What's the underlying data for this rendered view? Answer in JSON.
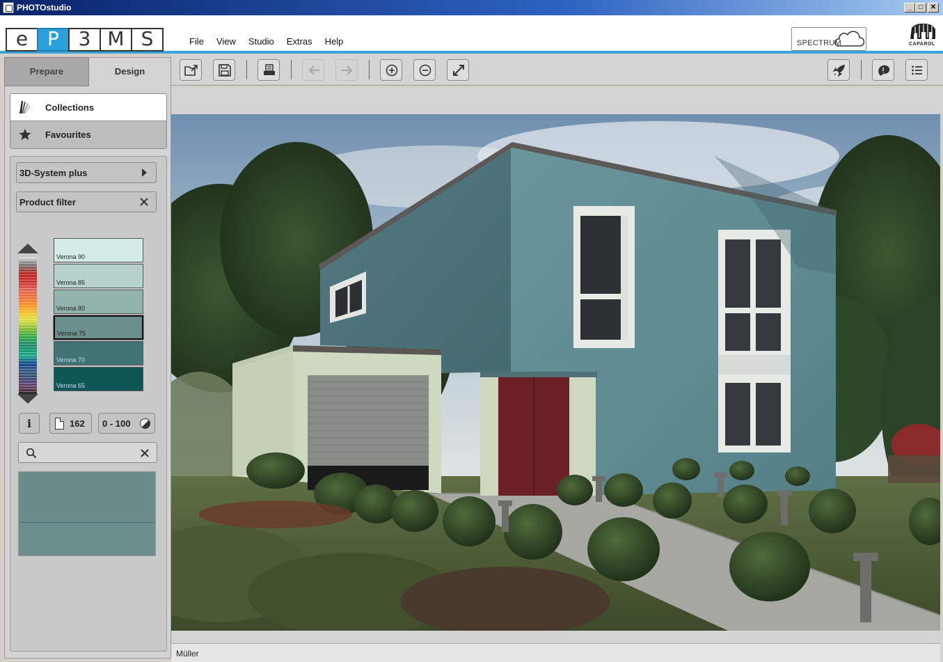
{
  "window": {
    "title": "PHOTOstudio",
    "minimize": "_",
    "maximize": "□",
    "close": "✕"
  },
  "logo_tiles": [
    "e",
    "P",
    "3",
    "M",
    "S"
  ],
  "menu": [
    "File",
    "View",
    "Studio",
    "Extras",
    "Help"
  ],
  "spectrum_label": "SPECTRUM",
  "brand": "CAPAROL",
  "tabs": {
    "prepare": "Prepare",
    "design": "Design"
  },
  "collections": {
    "collections_label": "Collections",
    "favourites_label": "Favourites"
  },
  "filters": {
    "system": "3D-System plus",
    "product_filter": "Product filter"
  },
  "swatches": [
    {
      "name": "Verona 90",
      "color": "#d3ebe6"
    },
    {
      "name": "Verona 85",
      "color": "#b5d2cd"
    },
    {
      "name": "Verona 80",
      "color": "#93b3ae"
    },
    {
      "name": "Verona 75",
      "color": "#6b8f8c"
    },
    {
      "name": "Verona 70",
      "color": "#3f7374"
    },
    {
      "name": "Verona 65",
      "color": "#0f5657"
    }
  ],
  "buttons": {
    "info": "i",
    "count": "162",
    "range": "0 - 100"
  },
  "search": {
    "value": "",
    "placeholder": ""
  },
  "preview": {
    "top_color": "#6a8d8c",
    "bottom_color": "#6b8f8d"
  },
  "status": {
    "user": "Müller"
  },
  "colors": {
    "accent": "#2ba0dd",
    "facade": "#5f8a8f",
    "door": "#6b2027",
    "garage": "#d0d9c1"
  }
}
